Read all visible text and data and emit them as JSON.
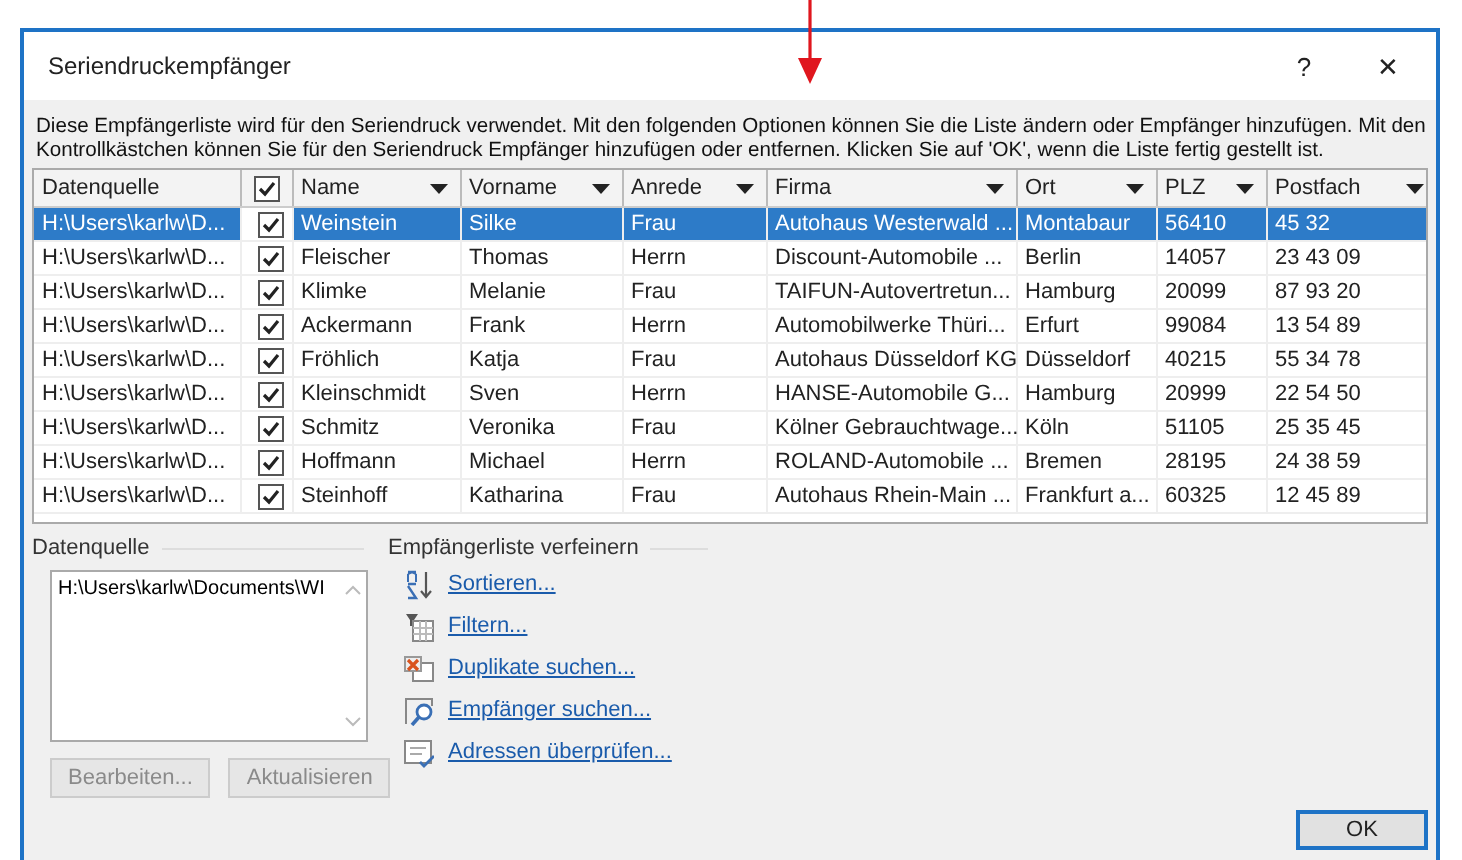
{
  "window": {
    "title": "Seriendruckempfänger",
    "help": "?",
    "close": "✕"
  },
  "description": "Diese Empfängerliste wird für den Seriendruck verwendet. Mit den folgenden Optionen können Sie die Liste ändern oder Empfänger hinzufügen. Mit den Kontrollkästchen können Sie für den Seriendruck Empfänger hinzufügen oder entfernen. Klicken Sie auf 'OK', wenn die Liste fertig gestellt ist.",
  "table": {
    "columns": [
      {
        "kind": "text",
        "label": "Datenquelle"
      },
      {
        "kind": "check",
        "checked": true
      },
      {
        "kind": "filter",
        "label": "Name"
      },
      {
        "kind": "filter",
        "label": "Vorname"
      },
      {
        "kind": "filter",
        "label": "Anrede"
      },
      {
        "kind": "filter",
        "label": "Firma"
      },
      {
        "kind": "filter",
        "label": "Ort"
      },
      {
        "kind": "filter",
        "label": "PLZ"
      },
      {
        "kind": "filter",
        "label": "Postfach"
      }
    ],
    "rows": [
      {
        "selected": true,
        "checked": true,
        "cells": [
          "H:\\Users\\karlw\\D...",
          "",
          "Weinstein",
          "Silke",
          "Frau",
          "Autohaus Westerwald ...",
          "Montabaur",
          "56410",
          "45 32"
        ]
      },
      {
        "selected": false,
        "checked": true,
        "cells": [
          "H:\\Users\\karlw\\D...",
          "",
          "Fleischer",
          "Thomas",
          "Herrn",
          "Discount-Automobile ...",
          "Berlin",
          "14057",
          "23 43 09"
        ]
      },
      {
        "selected": false,
        "checked": true,
        "cells": [
          "H:\\Users\\karlw\\D...",
          "",
          "Klimke",
          "Melanie",
          "Frau",
          "TAIFUN-Autovertretun...",
          "Hamburg",
          "20099",
          "87 93 20"
        ]
      },
      {
        "selected": false,
        "checked": true,
        "cells": [
          "H:\\Users\\karlw\\D...",
          "",
          "Ackermann",
          "Frank",
          "Herrn",
          "Automobilwerke Thüri...",
          "Erfurt",
          "99084",
          "13 54 89"
        ]
      },
      {
        "selected": false,
        "checked": true,
        "cells": [
          "H:\\Users\\karlw\\D...",
          "",
          "Fröhlich",
          "Katja",
          "Frau",
          "Autohaus Düsseldorf KG",
          "Düsseldorf",
          "40215",
          "55 34 78"
        ]
      },
      {
        "selected": false,
        "checked": true,
        "cells": [
          "H:\\Users\\karlw\\D...",
          "",
          "Kleinschmidt",
          "Sven",
          "Herrn",
          "HANSE-Automobile G...",
          "Hamburg",
          "20999",
          "22 54 50"
        ]
      },
      {
        "selected": false,
        "checked": true,
        "cells": [
          "H:\\Users\\karlw\\D...",
          "",
          "Schmitz",
          "Veronika",
          "Frau",
          "Kölner Gebrauchtwage...",
          "Köln",
          "51105",
          "25 35 45"
        ]
      },
      {
        "selected": false,
        "checked": true,
        "cells": [
          "H:\\Users\\karlw\\D...",
          "",
          "Hoffmann",
          "Michael",
          "Herrn",
          "ROLAND-Automobile ...",
          "Bremen",
          "28195",
          "24 38 59"
        ]
      },
      {
        "selected": false,
        "checked": true,
        "cells": [
          "H:\\Users\\karlw\\D...",
          "",
          "Steinhoff",
          "Katharina",
          "Frau",
          "Autohaus Rhein-Main ...",
          "Frankfurt a...",
          "60325",
          "12 45 89"
        ]
      }
    ]
  },
  "data_source": {
    "label": "Datenquelle",
    "items": [
      "H:\\Users\\karlw\\Documents\\WI"
    ],
    "buttons": [
      {
        "label": "Bearbeiten...",
        "disabled": true
      },
      {
        "label": "Aktualisieren",
        "disabled": true
      }
    ]
  },
  "refine": {
    "label": "Empfängerliste verfeinern",
    "links": [
      {
        "kind": "sort",
        "label": "Sortieren..."
      },
      {
        "kind": "filter",
        "label": "Filtern..."
      },
      {
        "kind": "duplicates",
        "label": "Duplikate suchen..."
      },
      {
        "kind": "find",
        "label": "Empfänger suchen..."
      },
      {
        "kind": "validate",
        "label": "Adressen überprüfen..."
      }
    ]
  },
  "ok_button": "OK"
}
